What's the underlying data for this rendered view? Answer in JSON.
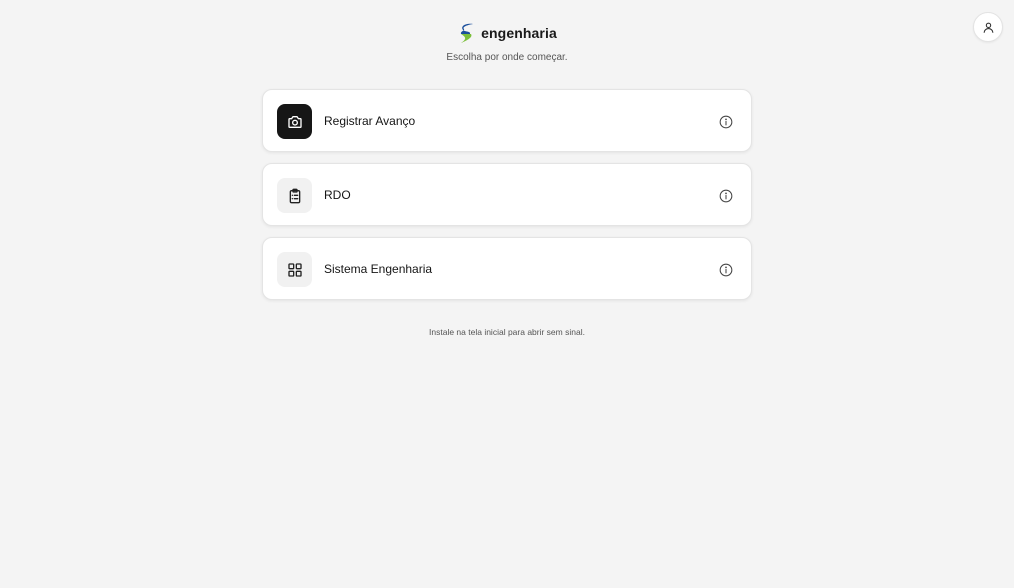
{
  "header": {
    "brand_name": "engenharia",
    "subtitle": "Escolha por onde começar.",
    "logo_icon": "s-logo-icon",
    "profile_icon": "user-icon"
  },
  "cards": [
    {
      "label": "Registrar Avanço",
      "icon": "camera-icon",
      "info_icon": "info-icon"
    },
    {
      "label": "RDO",
      "icon": "clipboard-list-icon",
      "info_icon": "info-icon"
    },
    {
      "label": "Sistema Engenharia",
      "icon": "grid-icon",
      "info_icon": "info-icon"
    }
  ],
  "footer": {
    "hint": "Instale na tela inicial para abrir sem sinal."
  },
  "colors": {
    "background": "#f4f4f4",
    "card": "#ffffff",
    "dark_icon_bg": "#161616",
    "logo_green": "#7bbf3a",
    "logo_blue": "#1b4f9c"
  }
}
